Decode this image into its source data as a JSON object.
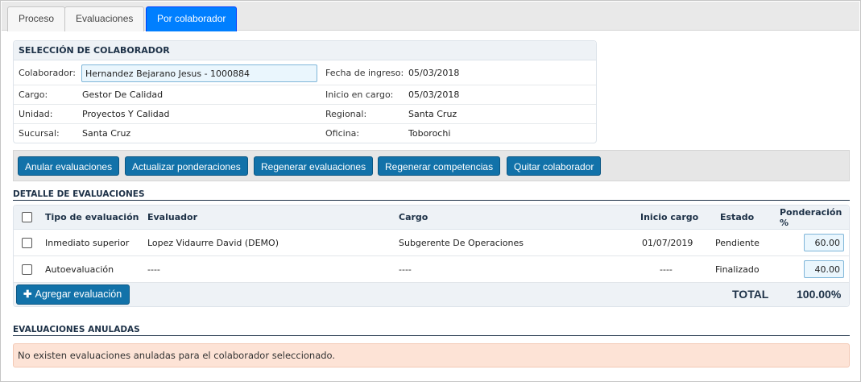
{
  "tabs": [
    {
      "label": "Proceso",
      "active": false
    },
    {
      "label": "Evaluaciones",
      "active": false
    },
    {
      "label": "Por colaborador",
      "active": true
    }
  ],
  "colors": {
    "accent": "#007fff",
    "button": "#1272a9",
    "header_text": "#1d3147",
    "alert_bg": "#fde3d6"
  },
  "selection": {
    "title": "SELECCIÓN DE COLABORADOR",
    "colaborador_label": "Colaborador:",
    "colaborador_value": "Hernandez Bejarano Jesus - 1000884",
    "fecha_ingreso_label": "Fecha de ingreso:",
    "fecha_ingreso_value": "05/03/2018",
    "cargo_label": "Cargo:",
    "cargo_value": "Gestor De Calidad",
    "inicio_cargo_label": "Inicio en cargo:",
    "inicio_cargo_value": "05/03/2018",
    "unidad_label": "Unidad:",
    "unidad_value": "Proyectos Y Calidad",
    "regional_label": "Regional:",
    "regional_value": "Santa Cruz",
    "sucursal_label": "Sucursal:",
    "sucursal_value": "Santa Cruz",
    "oficina_label": "Oficina:",
    "oficina_value": "Toborochi"
  },
  "toolbar": {
    "anular": "Anular evaluaciones",
    "actualizar": "Actualizar ponderaciones",
    "regenerar_eval": "Regenerar evaluaciones",
    "regenerar_comp": "Regenerar competencias",
    "quitar": "Quitar colaborador"
  },
  "detalle": {
    "title": "DETALLE DE EVALUACIONES",
    "headers": {
      "tipo": "Tipo de evaluación",
      "evaluador": "Evaluador",
      "cargo": "Cargo",
      "inicio": "Inicio cargo",
      "estado": "Estado",
      "ponderacion": "Ponderación %"
    },
    "rows": [
      {
        "tipo": "Inmediato superior",
        "evaluador": "Lopez Vidaurre David (DEMO)",
        "cargo": "Subgerente De Operaciones",
        "inicio": "01/07/2019",
        "estado": "Pendiente",
        "ponderacion": "60.00"
      },
      {
        "tipo": "Autoevaluación",
        "evaluador": "----",
        "cargo": "----",
        "inicio": "----",
        "estado": "Finalizado",
        "ponderacion": "40.00"
      }
    ],
    "add_button": "Agregar evaluación",
    "total_label": "TOTAL",
    "total_value": "100.00%"
  },
  "anuladas": {
    "title": "EVALUACIONES ANULADAS",
    "message": "No existen evaluaciones anuladas para el colaborador seleccionado."
  }
}
